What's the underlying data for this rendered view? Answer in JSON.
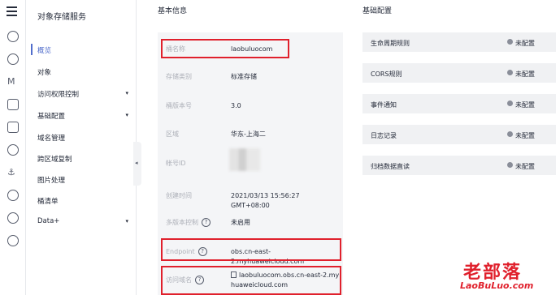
{
  "nav": {
    "title": "对象存储服务",
    "items": [
      {
        "label": "概览",
        "active": true,
        "has_submenu": false
      },
      {
        "label": "对象",
        "active": false,
        "has_submenu": false
      },
      {
        "label": "访问权限控制",
        "active": false,
        "has_submenu": true
      },
      {
        "label": "基础配置",
        "active": false,
        "has_submenu": true
      },
      {
        "label": "域名管理",
        "active": false,
        "has_submenu": false
      },
      {
        "label": "跨区域复制",
        "active": false,
        "has_submenu": false
      },
      {
        "label": "图片处理",
        "active": false,
        "has_submenu": false
      },
      {
        "label": "桶清单",
        "active": false,
        "has_submenu": false
      },
      {
        "label": "Data+",
        "active": false,
        "has_submenu": true
      }
    ],
    "chevron": "▾",
    "collapse_glyph": "◂"
  },
  "basic_info": {
    "title": "基本信息",
    "rows": [
      {
        "label": "桶名称",
        "value": "laobuluocom"
      },
      {
        "label": "存储类别",
        "value": "标准存储"
      },
      {
        "label": "桶版本号",
        "value": "3.0"
      },
      {
        "label": "区域",
        "value": "华东-上海二"
      },
      {
        "label": "帐号ID",
        "value": ""
      },
      {
        "label": "创建时间",
        "value": "2021/03/13 15:56:27 GMT+08:00"
      },
      {
        "label": "多版本控制",
        "value": "未启用"
      },
      {
        "label": "Endpoint",
        "value": "obs.cn-east-2.myhuaweicloud.com"
      },
      {
        "label": "访问域名",
        "value": "laobuluocom.obs.cn-east-2.myhuaweicloud.com"
      }
    ],
    "help_glyph": "?"
  },
  "basic_config": {
    "title": "基础配置",
    "items": [
      {
        "name": "生命周期规则",
        "state": "未配置"
      },
      {
        "name": "CORS规则",
        "state": "未配置"
      },
      {
        "name": "事件通知",
        "state": "未配置"
      },
      {
        "name": "日志记录",
        "state": "未配置"
      },
      {
        "name": "归档数据直读",
        "state": "未配置"
      }
    ]
  },
  "watermark": {
    "cn": "老部落",
    "en": "LaoBuLuo.com"
  },
  "colors": {
    "accent": "#526ecc",
    "highlight": "#e0202c",
    "panel": "#f4f5f7"
  }
}
